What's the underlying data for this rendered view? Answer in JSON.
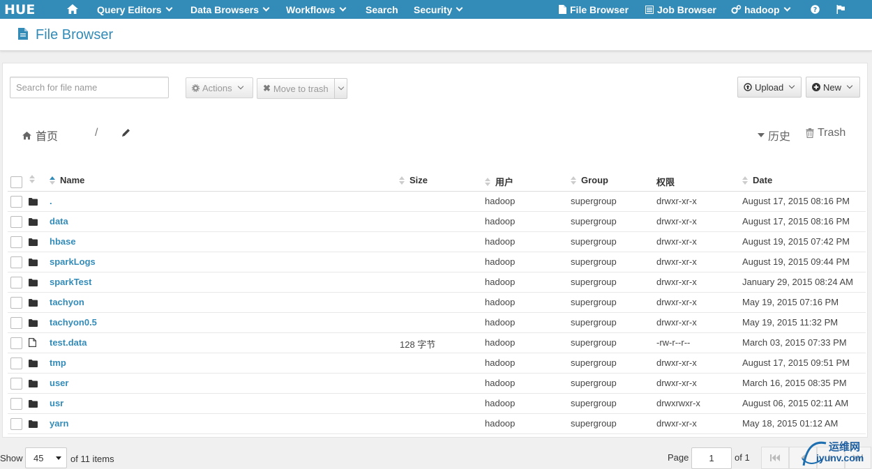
{
  "navbar": {
    "logo": "HUE",
    "items": [
      {
        "label": "Query Editors",
        "dropdown": true
      },
      {
        "label": "Data Browsers",
        "dropdown": true
      },
      {
        "label": "Workflows",
        "dropdown": true
      },
      {
        "label": "Search",
        "dropdown": false
      },
      {
        "label": "Security",
        "dropdown": true
      }
    ],
    "file_browser": "File Browser",
    "job_browser": "Job Browser",
    "user": "hadoop"
  },
  "header": {
    "title": "File Browser"
  },
  "toolbar": {
    "search_placeholder": "Search for file name",
    "actions_label": "Actions",
    "move_to_trash_label": "Move to trash",
    "upload_label": "Upload",
    "new_label": "New"
  },
  "breadcrumb": {
    "home": "首页",
    "separator": "/",
    "history": "历史",
    "trash": "Trash"
  },
  "table": {
    "columns": [
      "Name",
      "Size",
      "用户",
      "Group",
      "权限",
      "Date"
    ],
    "rows": [
      {
        "type": "folder",
        "name": ".",
        "size": "",
        "user": "hadoop",
        "group": "supergroup",
        "perm": "drwxr-xr-x",
        "date": "August 17, 2015 08:16 PM"
      },
      {
        "type": "folder",
        "name": "data",
        "size": "",
        "user": "hadoop",
        "group": "supergroup",
        "perm": "drwxr-xr-x",
        "date": "August 17, 2015 08:16 PM"
      },
      {
        "type": "folder",
        "name": "hbase",
        "size": "",
        "user": "hadoop",
        "group": "supergroup",
        "perm": "drwxr-xr-x",
        "date": "August 19, 2015 07:42 PM"
      },
      {
        "type": "folder",
        "name": "sparkLogs",
        "size": "",
        "user": "hadoop",
        "group": "supergroup",
        "perm": "drwxr-xr-x",
        "date": "August 19, 2015 09:44 PM"
      },
      {
        "type": "folder",
        "name": "sparkTest",
        "size": "",
        "user": "hadoop",
        "group": "supergroup",
        "perm": "drwxr-xr-x",
        "date": "January 29, 2015 08:24 AM"
      },
      {
        "type": "folder",
        "name": "tachyon",
        "size": "",
        "user": "hadoop",
        "group": "supergroup",
        "perm": "drwxr-xr-x",
        "date": "May 19, 2015 07:16 PM"
      },
      {
        "type": "folder",
        "name": "tachyon0.5",
        "size": "",
        "user": "hadoop",
        "group": "supergroup",
        "perm": "drwxr-xr-x",
        "date": "May 19, 2015 11:32 PM"
      },
      {
        "type": "file",
        "name": "test.data",
        "size": "128 字节",
        "user": "hadoop",
        "group": "supergroup",
        "perm": "-rw-r--r--",
        "date": "March 03, 2015 07:33 PM"
      },
      {
        "type": "folder",
        "name": "tmp",
        "size": "",
        "user": "hadoop",
        "group": "supergroup",
        "perm": "drwxr-xr-x",
        "date": "August 17, 2015 09:51 PM"
      },
      {
        "type": "folder",
        "name": "user",
        "size": "",
        "user": "hadoop",
        "group": "supergroup",
        "perm": "drwxr-xr-x",
        "date": "March 16, 2015 08:35 PM"
      },
      {
        "type": "folder",
        "name": "usr",
        "size": "",
        "user": "hadoop",
        "group": "supergroup",
        "perm": "drwxrwxr-x",
        "date": "August 06, 2015 02:11 AM"
      },
      {
        "type": "folder",
        "name": "yarn",
        "size": "",
        "user": "hadoop",
        "group": "supergroup",
        "perm": "drwxr-xr-x",
        "date": "May 18, 2015 01:12 AM"
      }
    ]
  },
  "footer": {
    "show_label": "Show",
    "page_size": "45",
    "items_label": "of 11 items",
    "page_label": "Page",
    "page_value": "1",
    "of_pages": "of 1"
  },
  "watermark": {
    "line1": "运维网",
    "line2": "iyunv.com"
  },
  "colors": {
    "brand": "#338bb8",
    "link": "#338bb8"
  }
}
